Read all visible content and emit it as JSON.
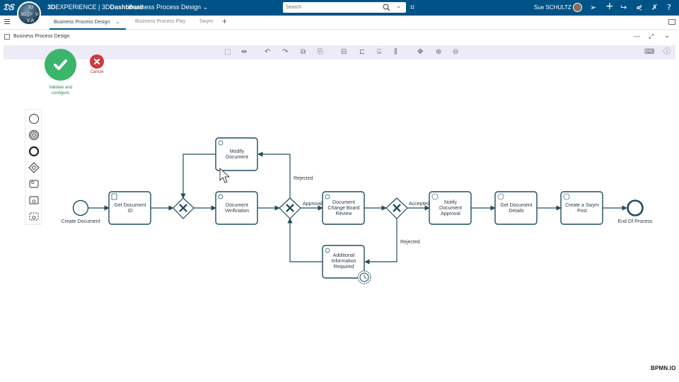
{
  "topbar": {
    "brand_strong": "3D",
    "brand_rest": "EXPERIENCE | 3D",
    "brand_app": "Dashboard",
    "dashboard_title": "Business Process Design",
    "search_placeholder": "Search",
    "user_name": "Sue SCHULTZ",
    "compass_labels": {
      "top": "3D",
      "left": "3D",
      "right": "V",
      "bottom": "V,R"
    }
  },
  "tabs": [
    {
      "label": "Business Process Design"
    },
    {
      "label": "Business Process Play"
    },
    {
      "label": "Swym"
    }
  ],
  "widget": {
    "title": "Business Process Design"
  },
  "actions": {
    "validate_label_line1": "Validate and",
    "validate_label_line2": "configure",
    "cancel_label": "Cancel"
  },
  "diagram": {
    "start_event": "Create Document",
    "end_event": "End Of Process",
    "tasks": {
      "get_id": [
        "Get Document",
        "ID"
      ],
      "modify": [
        "Modify",
        "Document"
      ],
      "verify": [
        "Document",
        "Verification"
      ],
      "review": [
        "Document",
        "Change Board",
        "Review"
      ],
      "additional": [
        "Additional",
        "Information",
        "Required"
      ],
      "notify": [
        "Notify",
        "Document",
        "Approval"
      ],
      "details": [
        "Get Document",
        "Details"
      ],
      "swym": [
        "Create a Swym",
        "Post"
      ]
    },
    "flow_labels": {
      "rejected_top": "Rejected",
      "approval": "Approval",
      "accepted": "Accepted",
      "rejected_bottom": "Rejected"
    }
  },
  "footer": {
    "bpmn_logo": "BPMN.IO"
  },
  "colors": {
    "topbar": "#005386",
    "shape_stroke": "#1f4d5e",
    "validate": "#3bb56a",
    "cancel": "#d2383e",
    "toolbar_bg": "#ecebf6"
  }
}
